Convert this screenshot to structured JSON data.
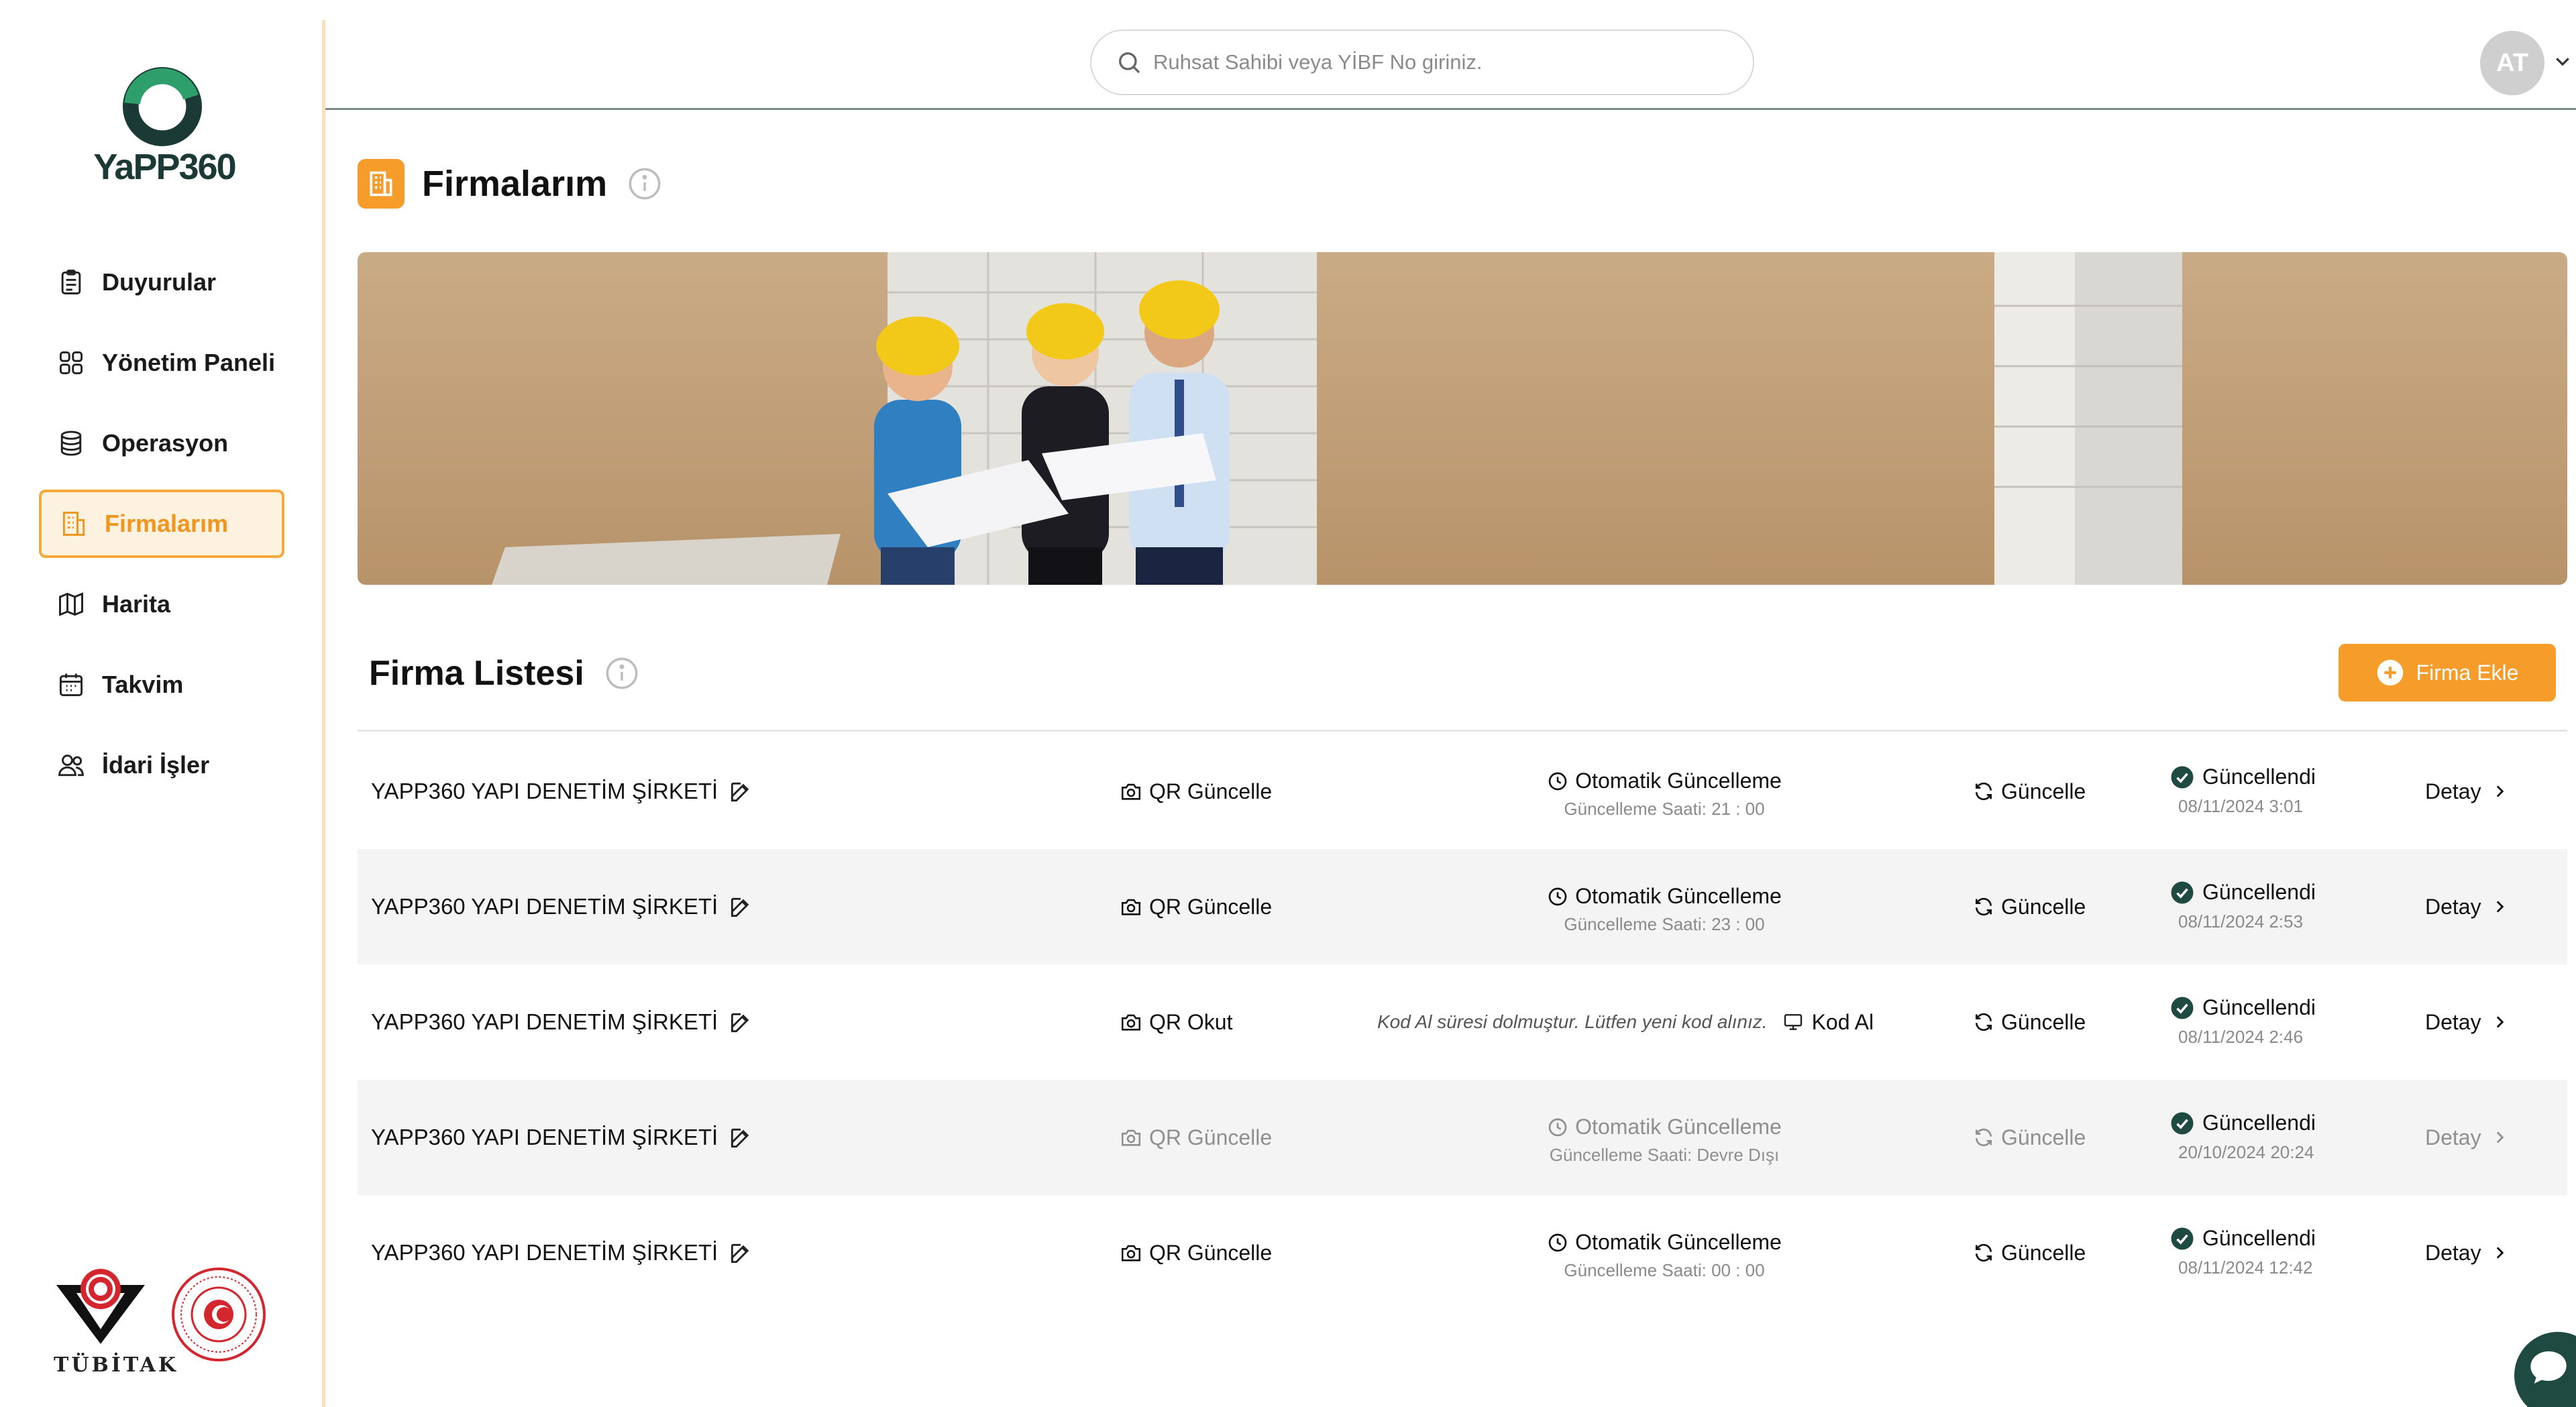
{
  "app": {
    "logo_text_primary": "YaPP",
    "logo_text_secondary": "360",
    "brand_color": "#1c3a35",
    "accent_color": "#f59c2a"
  },
  "sidebar": {
    "items": [
      {
        "label": "Duyurular",
        "icon": "clipboard-icon",
        "active": false
      },
      {
        "label": "Yönetim Paneli",
        "icon": "grid-icon",
        "active": false
      },
      {
        "label": "Operasyon",
        "icon": "database-icon",
        "active": false
      },
      {
        "label": "Firmalarım",
        "icon": "building-icon",
        "active": true
      },
      {
        "label": "Harita",
        "icon": "map-icon",
        "active": false
      },
      {
        "label": "Takvim",
        "icon": "calendar-icon",
        "active": false
      },
      {
        "label": "İdari İşler",
        "icon": "users-icon",
        "active": false
      }
    ],
    "bottom_logo_text": "TÜBİTAK"
  },
  "header": {
    "search_placeholder": "Ruhsat Sahibi veya YİBF No giriniz.",
    "avatar_initials": "AT"
  },
  "page": {
    "title": "Firmalarım",
    "list_title": "Firma Listesi",
    "add_button_label": "Firma Ekle"
  },
  "firms": [
    {
      "name": "YAPP360 YAPI DENETİM ŞİRKETİ",
      "qr_label": "QR Güncelle",
      "mode": "auto",
      "auto_label": "Otomatik Güncelleme",
      "auto_sub": "Güncelleme Saati: 21 : 00",
      "refresh_label": "Güncelle",
      "status_label": "Güncellendi",
      "status_date": "08/11/2024 3:01",
      "detail_label": "Detay",
      "disabled": false
    },
    {
      "name": "YAPP360 YAPI DENETİM ŞİRKETİ",
      "qr_label": "QR Güncelle",
      "mode": "auto",
      "auto_label": "Otomatik Güncelleme",
      "auto_sub": "Güncelleme Saati: 23 : 00",
      "refresh_label": "Güncelle",
      "status_label": "Güncellendi",
      "status_date": "08/11/2024 2:53",
      "detail_label": "Detay",
      "disabled": false
    },
    {
      "name": "YAPP360 YAPI DENETİM ŞİRKETİ",
      "qr_label": "QR Okut",
      "mode": "expired",
      "expired_text": "Kod Al süresi dolmuştur. Lütfen yeni kod alınız.",
      "code_label": "Kod Al",
      "refresh_label": "Güncelle",
      "status_label": "Güncellendi",
      "status_date": "08/11/2024 2:46",
      "detail_label": "Detay",
      "disabled": false
    },
    {
      "name": "YAPP360 YAPI DENETİM ŞİRKETİ",
      "qr_label": "QR Güncelle",
      "mode": "auto",
      "auto_label": "Otomatik Güncelleme",
      "auto_sub": "Güncelleme Saati: Devre Dışı",
      "refresh_label": "Güncelle",
      "status_label": "Güncellendi",
      "status_date": "20/10/2024 20:24",
      "detail_label": "Detay",
      "disabled": true
    },
    {
      "name": "YAPP360 YAPI DENETİM ŞİRKETİ",
      "qr_label": "QR Güncelle",
      "mode": "auto",
      "auto_label": "Otomatik Güncelleme",
      "auto_sub": "Güncelleme Saati: 00 : 00",
      "refresh_label": "Güncelle",
      "status_label": "Güncellendi",
      "status_date": "08/11/2024 12:42",
      "detail_label": "Detay",
      "disabled": false
    }
  ]
}
